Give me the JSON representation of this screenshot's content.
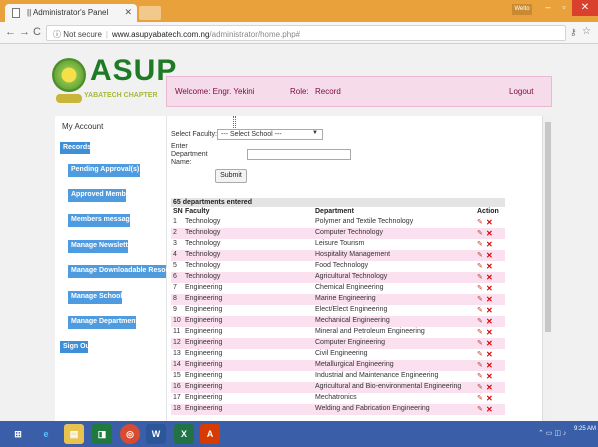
{
  "browser": {
    "tab_title": "Administrator's Panel",
    "tab_prefix": "|| ",
    "url_secure": "Not secure",
    "url_host": "www.asupyabatech.com.ng",
    "url_path": "/administrator/home.php#",
    "user_badge": "Welto"
  },
  "brand": {
    "logo_text": "ASUP",
    "logo_sub": "YABATECH CHAPTER"
  },
  "header": {
    "welcome": "Welcome: Engr. Yekini",
    "role_label": "Role:",
    "role_value": "Record",
    "logout": "Logout"
  },
  "sidebar": {
    "my_account": "My Account",
    "records": "Records",
    "items": [
      "Pending Approval(s)",
      "Approved Members",
      "Members messages",
      "Manage Newsletter",
      "Manage Downloadable Resources",
      "Manage Schools",
      "Manage Departments"
    ],
    "sign_out": "Sign Out"
  },
  "form": {
    "faculty_label": "Select Faculty:",
    "faculty_value": "--- Select School ---",
    "dept_label_1": "Enter",
    "dept_label_2": "Department",
    "dept_label_3": "Name:",
    "submit": "Submit"
  },
  "table": {
    "count_text": "65 departments entered",
    "headers": {
      "sn": "SN",
      "faculty": "Faculty",
      "department": "Department",
      "action": "Action"
    },
    "rows": [
      {
        "sn": "1",
        "faculty": "Technology",
        "department": "Polymer and Textile Technology"
      },
      {
        "sn": "2",
        "faculty": "Technology",
        "department": "Computer Technology"
      },
      {
        "sn": "3",
        "faculty": "Technology",
        "department": "Leisure Tourism"
      },
      {
        "sn": "4",
        "faculty": "Technology",
        "department": "Hospitality Management"
      },
      {
        "sn": "5",
        "faculty": "Technology",
        "department": "Food Technology"
      },
      {
        "sn": "6",
        "faculty": "Technology",
        "department": "Agricultural Technology"
      },
      {
        "sn": "7",
        "faculty": "Engineering",
        "department": "Chemical Engineering"
      },
      {
        "sn": "8",
        "faculty": "Engineering",
        "department": "Marine Engineering"
      },
      {
        "sn": "9",
        "faculty": "Engineering",
        "department": "Elect/Elect Engineering"
      },
      {
        "sn": "10",
        "faculty": "Engineering",
        "department": "Mechanical Engineering"
      },
      {
        "sn": "11",
        "faculty": "Engineering",
        "department": "Mineral and Petroleum Engineering"
      },
      {
        "sn": "12",
        "faculty": "Engineering",
        "department": "Computer Engineering"
      },
      {
        "sn": "13",
        "faculty": "Engineering",
        "department": "Civil Engineering"
      },
      {
        "sn": "14",
        "faculty": "Engineering",
        "department": "Metallurgical Engineering"
      },
      {
        "sn": "15",
        "faculty": "Engineering",
        "department": "Industrial and Maintenance Engineering"
      },
      {
        "sn": "16",
        "faculty": "Engineering",
        "department": "Agricultural and Bio-environmental Engineering"
      },
      {
        "sn": "17",
        "faculty": "Engineering",
        "department": "Mechatronics"
      },
      {
        "sn": "18",
        "faculty": "Engineering",
        "department": "Welding and Fabrication Engineering"
      }
    ]
  },
  "taskbar": {
    "clock_time": "9:25 AM"
  },
  "colors": {
    "title_bar": "#e9a23b",
    "sidebar_button": "#4e9be0",
    "row_highlight": "#fbe0ef",
    "delete_icon": "#e10000",
    "taskbar": "#3a5fa8"
  }
}
